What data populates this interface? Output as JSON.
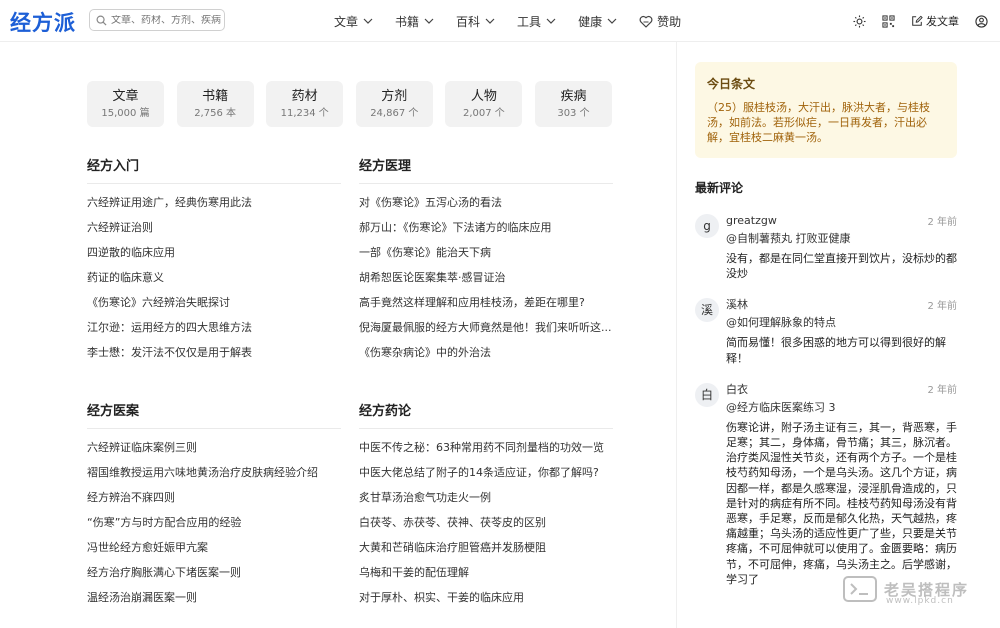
{
  "header": {
    "logo": "经方派",
    "search_placeholder": "文章、药材、方剂、疾病",
    "nav": [
      {
        "label": "文章"
      },
      {
        "label": "书籍"
      },
      {
        "label": "百科"
      },
      {
        "label": "工具"
      },
      {
        "label": "健康"
      }
    ],
    "donate_label": "赞助",
    "post_label": "发文章",
    "accent_color": "#1d5fd6"
  },
  "stats": [
    {
      "label": "文章",
      "count": "15,000 篇"
    },
    {
      "label": "书籍",
      "count": "2,756 本"
    },
    {
      "label": "药材",
      "count": "11,234 个"
    },
    {
      "label": "方剂",
      "count": "24,867 个"
    },
    {
      "label": "人物",
      "count": "2,007 个"
    },
    {
      "label": "疾病",
      "count": "303 个"
    }
  ],
  "sections": {
    "intro": {
      "title": "经方入门",
      "items": [
        "六经辨证用途广，经典伤寒用此法",
        "六经辨证治则",
        "四逆散的临床应用",
        "药证的临床意义",
        "《伤寒论》六经辨治失眠探讨",
        "江尔逊：运用经方的四大思维方法",
        "李士懋：发汗法不仅仅是用于解表"
      ]
    },
    "theory": {
      "title": "经方医理",
      "items": [
        "对《伤寒论》五泻心汤的看法",
        "郝万山：《伤寒论》下法诸方的临床应用",
        "一部《伤寒论》能治天下病",
        "胡希恕医论医案集萃·感冒证治",
        "高手竟然这样理解和应用桂枝汤，差距在哪里?",
        "倪海厦最佩服的经方大师竟然是他！我们来听听这...",
        "《伤寒杂病论》中的外治法"
      ]
    },
    "cases": {
      "title": "经方医案",
      "items": [
        "六经辨证临床案例三则",
        "褶国维教授运用六味地黄汤治疗皮肤病经验介绍",
        "经方辨治不寐四则",
        "“伤寒”方与时方配合应用的经验",
        "冯世纶经方愈妊娠甲亢案",
        "经方治疗胸胀满心下堵医案一则",
        "温经汤治崩漏医案一则"
      ]
    },
    "herbs": {
      "title": "经方药论",
      "items": [
        "中医不传之秘：63种常用药不同剂量档的功效一览",
        "中医大佬总结了附子的14条适应证，你都了解吗?",
        "炙甘草汤治愈气功走火一例",
        "白茯苓、赤茯苓、茯神、茯苓皮的区别",
        "大黄和芒硝临床治疗胆管癌并发肠梗阻",
        "乌梅和干姜的配伍理解",
        "对于厚朴、枳实、干姜的临床应用"
      ]
    }
  },
  "daily": {
    "title": "今日条文",
    "text": "（25）服桂枝汤，大汗出，脉洪大者，与桂枝汤，如前法。若形似疟，一日再发者，汗出必解，宜桂枝二麻黄一汤。"
  },
  "latest": {
    "title": "最新评论",
    "comments": [
      {
        "avatar": "g",
        "user": "greatzgw",
        "time": "2 年前",
        "ref": "@自制薯蓣丸 打败亚健康",
        "body": "没有，都是在同仁堂直接开到饮片，没标炒的都没炒"
      },
      {
        "avatar": "溪",
        "user": "溪林",
        "time": "2 年前",
        "ref": "@如何理解脉象的特点",
        "body": "简而易懂！很多困惑的地方可以得到很好的解释！"
      },
      {
        "avatar": "白",
        "user": "白衣",
        "time": "2 年前",
        "ref": "@经方临床医案练习 3",
        "body": "伤寒论讲，附子汤主证有三，其一，背恶寒，手足寒；其二，身体痛，骨节痛；其三，脉沉者。治疗类风湿性关节炎，还有两个方子。一个是桂枝芍药知母汤，一个是乌头汤。这几个方证，病因都一样，都是久感寒湿，浸淫肌骨造成的，只是针对的病症有所不同。桂枝芍药知母汤没有背恶寒，手足寒，反而是郁久化热，天气越热，疼痛越重；乌头汤的适应性更广了些，只要是关节疼痛，不可屈伸就可以使用了。金匮要略：病历节，不可屈伸，疼痛，乌头汤主之。后学感谢，学习了"
      }
    ]
  },
  "watermark": {
    "text": "老吴搭程序",
    "url": "www.lpkd.cn"
  }
}
